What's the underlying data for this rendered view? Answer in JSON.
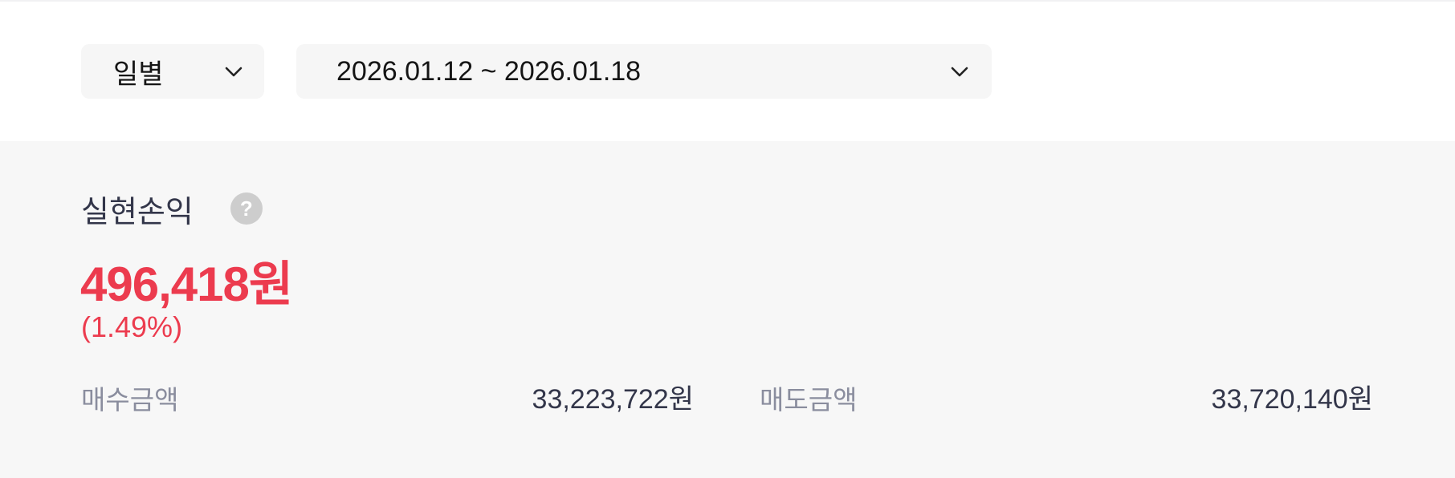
{
  "filters": {
    "period": {
      "selected": "일별",
      "icon": "chevron-down-icon"
    },
    "date_range": {
      "selected": "2026.01.12 ~ 2026.01.18",
      "icon": "chevron-down-icon"
    }
  },
  "summary": {
    "title": "실현손익",
    "help_icon": "question-mark-icon",
    "help_glyph": "?",
    "amount": "496,418원",
    "rate": "(1.49%)",
    "buy": {
      "label": "매수금액",
      "value": "33,223,722원"
    },
    "sell": {
      "label": "매도금액",
      "value": "33,720,140원"
    }
  },
  "colors": {
    "profit": "#ec3b4e",
    "text_primary": "#33364a",
    "text_secondary": "#8a8d9e",
    "panel_bg": "#f7f7f7",
    "select_bg": "#f6f6f6"
  }
}
